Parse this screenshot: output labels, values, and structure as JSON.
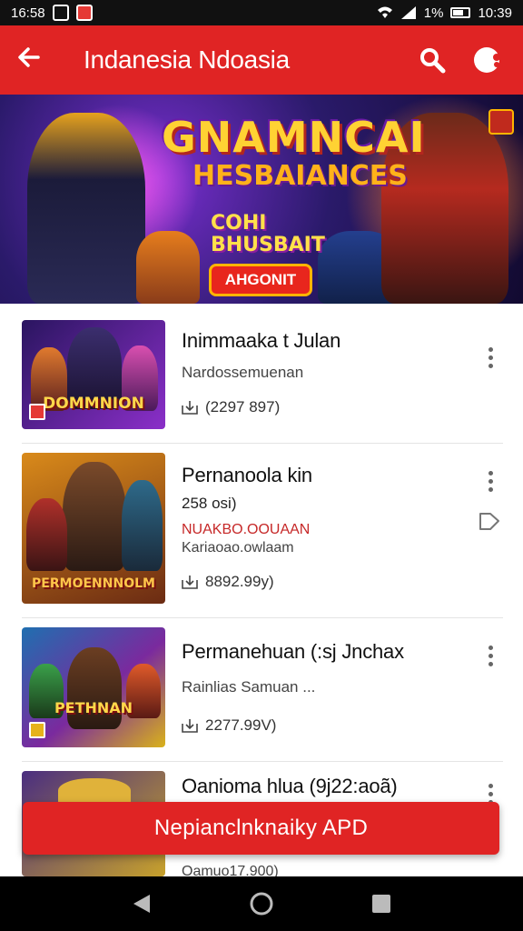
{
  "status_bar": {
    "time_left": "16:58",
    "battery_text": "1%",
    "time_right": "10:39"
  },
  "app_bar": {
    "back_icon": "arrow-left-icon",
    "title": "Indanesia Ndoasia",
    "search_icon": "search-icon",
    "menu_icon": "menu-icon"
  },
  "banner": {
    "title_line1": "GNAMNCAI",
    "title_line2": "HESBAIANCES",
    "subtitle_line1": "COHI",
    "subtitle_line2": "BHUSBAIT",
    "cta_label": "AHGONIT"
  },
  "games": [
    {
      "name": "Inimmaaka t Julan",
      "subtitle": "Nardossemuenan",
      "downloads": "(2297 897)",
      "thumb_caption": "DOMMNION",
      "colors": {
        "bg1": "#2a1560",
        "bg2": "#8b2fc9"
      }
    },
    {
      "name": "Pernanoola kin",
      "price": "258 osi)",
      "promo": "NUAKBO.OOUAAN",
      "subtitle": "Kariaoao.owlaam",
      "downloads": "8892.99y)",
      "thumb_caption": "PERMOENNNOLM",
      "colors": {
        "bg1": "#d98a1a",
        "bg2": "#6b2b13"
      }
    },
    {
      "name": "Permanehuan (:sj Jnchax",
      "subtitle": "Rainlias Samuan ...",
      "downloads": "2277.99V)",
      "thumb_caption": "PETHNAN",
      "colors": {
        "bg1": "#1f6fb0",
        "bg2": "#d9b21a"
      }
    },
    {
      "name": "Oanioma hlua (9j22:aoã)",
      "subtitle": "Oamuo17.900)",
      "thumb_caption": "",
      "colors": {
        "bg1": "#4a2e80",
        "bg2": "#c7a12b"
      }
    }
  ],
  "primary_button": {
    "label": "Nepianclnknaiky APD"
  },
  "nav_bar": {
    "back_icon": "triangle-back-icon",
    "home_icon": "circle-home-icon",
    "recents_icon": "square-recents-icon"
  },
  "accent_color": "#e02424"
}
